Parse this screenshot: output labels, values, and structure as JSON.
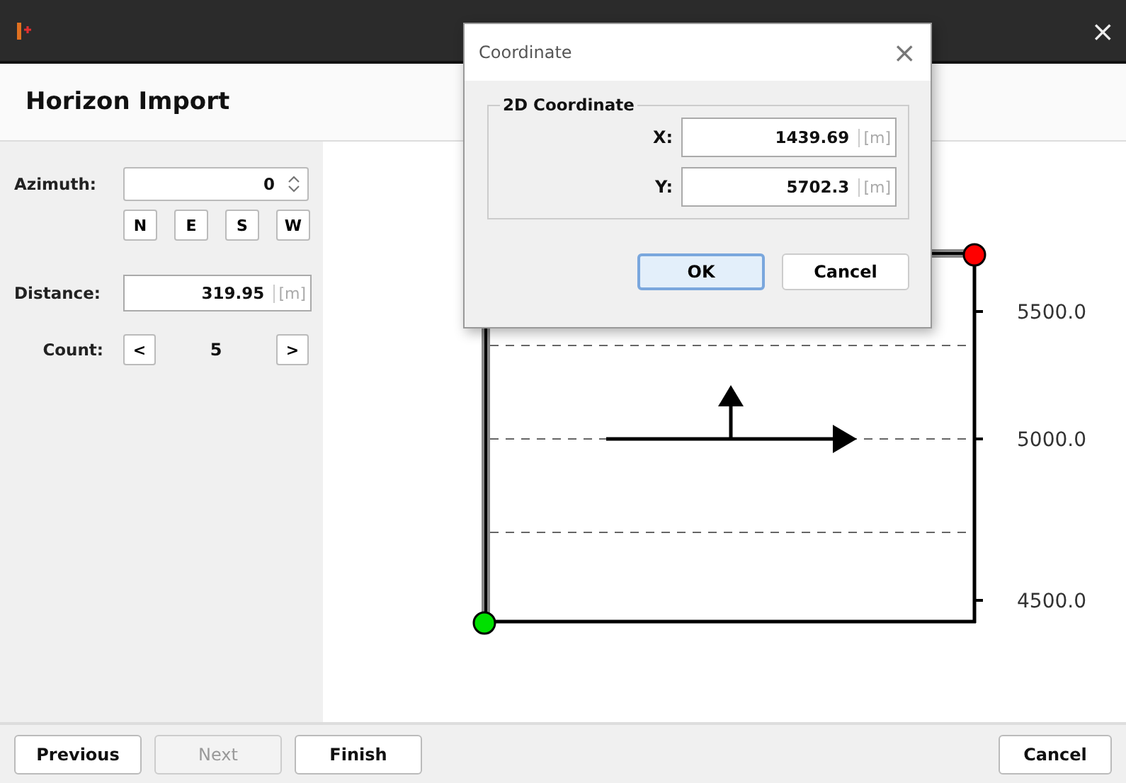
{
  "window": {
    "close": "×"
  },
  "header": {
    "title": "Horizon Import"
  },
  "form": {
    "azimuth": {
      "label": "Azimuth:",
      "value": "0"
    },
    "directions": [
      {
        "label": "N"
      },
      {
        "label": "E"
      },
      {
        "label": "S"
      },
      {
        "label": "W"
      }
    ],
    "distance": {
      "label": "Distance:",
      "value": "319.95",
      "unit": "[m]"
    },
    "count": {
      "label": "Count:",
      "prev": "<",
      "value": "5",
      "next": ">"
    }
  },
  "plot": {
    "tick_labels": [
      "5500.0",
      "5000.0",
      "4500.0"
    ]
  },
  "dialog": {
    "title": "Coordinate",
    "close": "×",
    "group": "2D Coordinate",
    "fields": [
      {
        "label": "X:",
        "value": "1439.69",
        "unit": "[m]"
      },
      {
        "label": "Y:",
        "value": "5702.3",
        "unit": "[m]"
      }
    ],
    "buttons": [
      {
        "label": "OK",
        "default": true
      },
      {
        "label": "Cancel",
        "default": false
      }
    ]
  },
  "footer": {
    "buttons": [
      {
        "label": "Previous",
        "disabled": false
      },
      {
        "label": "Next",
        "disabled": true
      },
      {
        "label": "Finish",
        "disabled": false
      }
    ],
    "cancel": "Cancel"
  }
}
